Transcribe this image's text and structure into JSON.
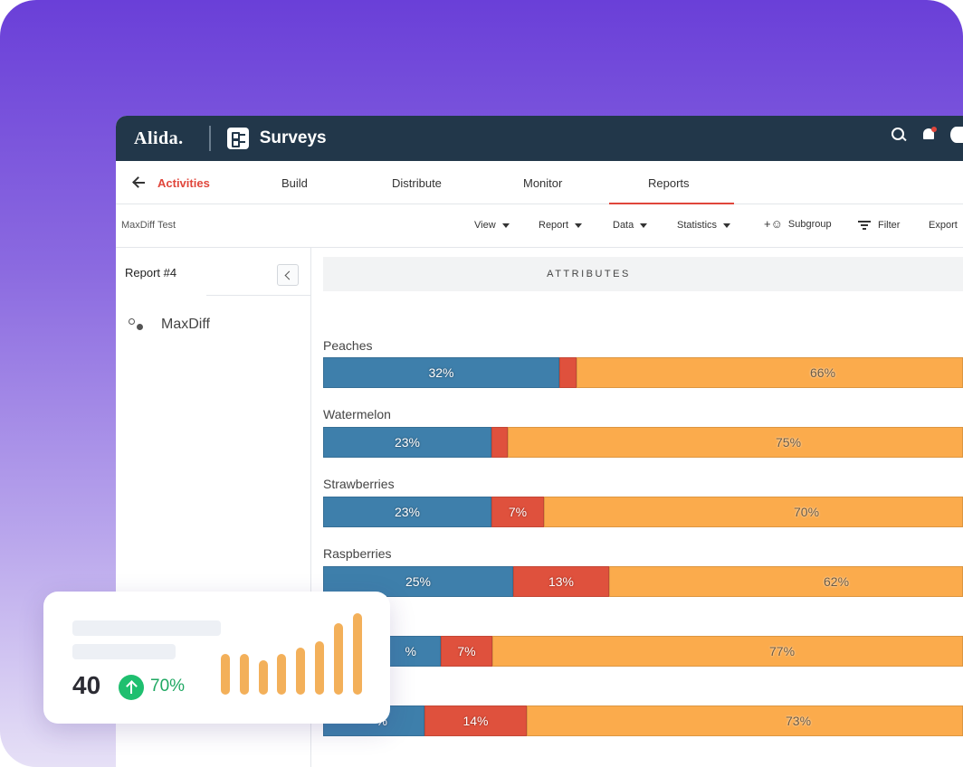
{
  "topbar": {
    "logo": "Alida.",
    "app_title": "Surveys",
    "icons": [
      "search-icon",
      "bell-icon",
      "settings-icon"
    ]
  },
  "nav": {
    "back_icon": "arrow-left-icon",
    "activities": "Activities",
    "tabs": [
      "Build",
      "Distribute",
      "Monitor",
      "Reports"
    ],
    "active_tab": "Reports"
  },
  "toolbar": {
    "survey_name": "MaxDiff Test",
    "view": "View",
    "report": "Report",
    "data": "Data",
    "statistics": "Statistics",
    "subgroup": "Subgroup",
    "filter": "Filter",
    "export": "Export"
  },
  "sidebar": {
    "report_title": "Report #4",
    "item": "MaxDiff"
  },
  "main": {
    "header": "ATTRIBUTES",
    "rows": [
      {
        "label": "Peaches",
        "blue": "32%",
        "red": "",
        "orange": "66%"
      },
      {
        "label": "Watermelon",
        "blue": "23%",
        "red": "",
        "orange": "75%"
      },
      {
        "label": "Strawberries",
        "blue": "23%",
        "red": "7%",
        "orange": "70%"
      },
      {
        "label": "Raspberries",
        "blue": "25%",
        "red": "13%",
        "orange": "62%"
      },
      {
        "label": "",
        "blue": "%",
        "red": "7%",
        "orange": "77%"
      },
      {
        "label": "",
        "blue": "%",
        "red": "14%",
        "orange": "73%"
      }
    ]
  },
  "chart_data": {
    "type": "bar",
    "categories": [
      "Peaches",
      "Watermelon",
      "Strawberries",
      "Raspberries"
    ],
    "series": [
      {
        "values": [
          32,
          23,
          23,
          25
        ]
      },
      {
        "values": [
          2,
          2,
          7,
          13
        ]
      },
      {
        "values": [
          66,
          75,
          70,
          62
        ]
      }
    ],
    "colors": [
      "#3e7fab",
      "#df513d",
      "#fbab4c"
    ]
  },
  "card": {
    "value": "40",
    "change": "70%",
    "icon": "arrow-up-icon",
    "bars": [
      0.5,
      0.5,
      0.42,
      0.5,
      0.58,
      0.66,
      0.88,
      1.0
    ],
    "bar_color": "#f3b05a"
  }
}
